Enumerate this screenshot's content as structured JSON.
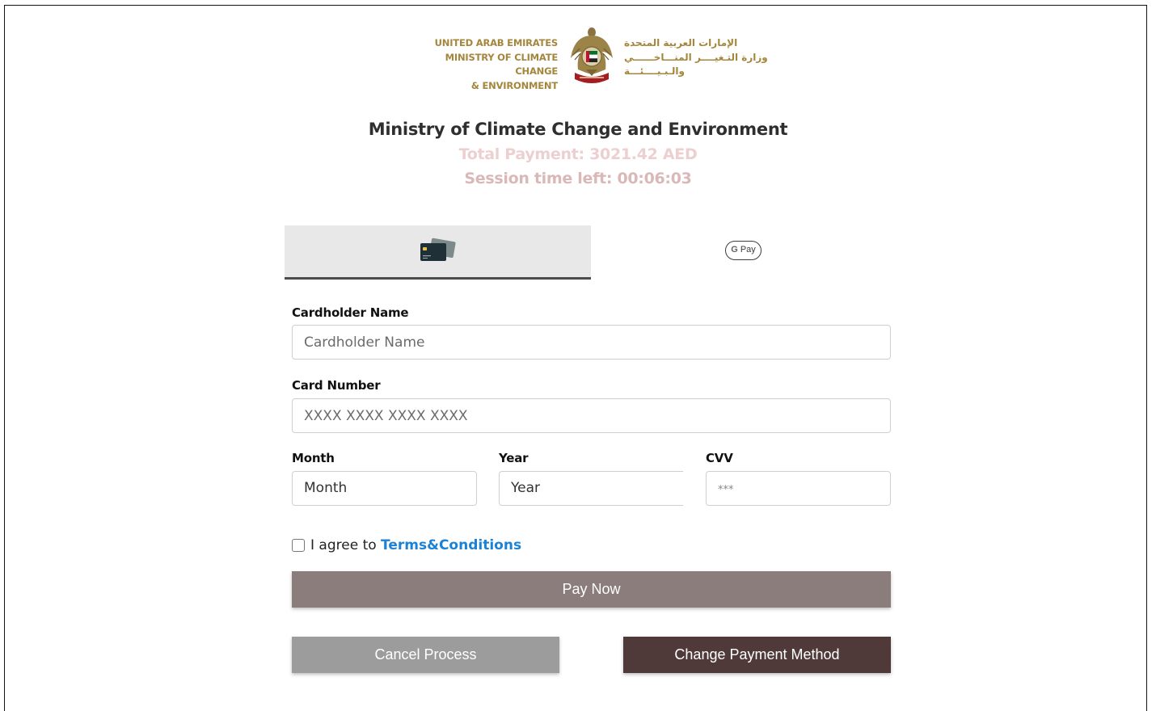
{
  "logo": {
    "en_line1": "UNITED ARAB EMIRATES",
    "en_line2": "MINISTRY OF CLIMATE CHANGE",
    "en_line3": "& ENVIRONMENT",
    "ar_line1": "الإمارات العربية المتحدة",
    "ar_line2": "وزارة التـغيــــر المنـــاخــــــي",
    "ar_line3": "والـبـيــــئـــة"
  },
  "header": {
    "title": "Ministry of Climate Change and Environment",
    "total_payment": "Total Payment: 3021.42 AED",
    "session_time": "Session time left: 00:06:03"
  },
  "tabs": {
    "gpay_g": "G",
    "gpay_text": "Pay"
  },
  "form": {
    "cardholder_label": "Cardholder Name",
    "cardholder_placeholder": "Cardholder Name",
    "card_number_label": "Card Number",
    "card_number_placeholder": "XXXX XXXX XXXX XXXX",
    "month_label": "Month",
    "month_value": "Month",
    "year_label": "Year",
    "year_value": "Year",
    "cvv_label": "CVV",
    "cvv_placeholder": "***",
    "agree_text": "I agree to ",
    "terms_link": "Terms&Conditions"
  },
  "buttons": {
    "pay_now": "Pay Now",
    "cancel": "Cancel Process",
    "change_method": "Change Payment Method"
  },
  "colors": {
    "pay_button": "#8b7d7b",
    "cancel_button": "#9c9c9c",
    "change_button": "#4f3a39",
    "terms_link": "#1b82d6",
    "logo_gold": "#a4863c"
  },
  "icons": {
    "card_tab": "credit-card-icon",
    "gpay_tab": "google-pay-icon",
    "emblem": "uae-emblem-icon"
  }
}
